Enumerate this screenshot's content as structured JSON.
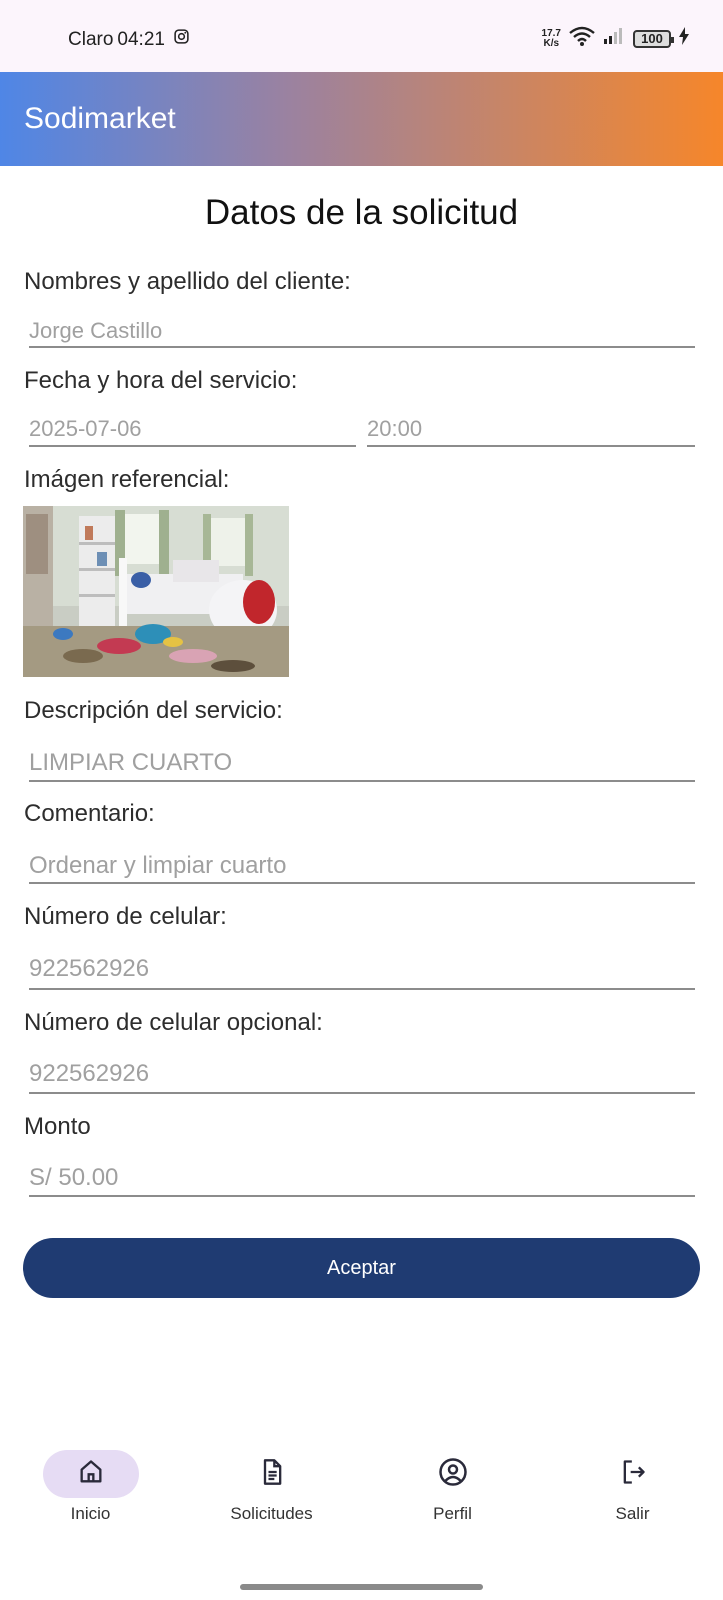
{
  "status_bar": {
    "carrier": "Claro",
    "time": "04:21",
    "net_speed_top": "17.7",
    "net_speed_bottom": "K/s",
    "battery": "100"
  },
  "app_bar": {
    "title": "Sodimarket"
  },
  "page": {
    "title": "Datos de la solicitud"
  },
  "form": {
    "client_label": "Nombres y apellido del cliente:",
    "client_value": "Jorge Castillo",
    "datetime_label": "Fecha y hora del servicio:",
    "date_value": "2025-07-06",
    "time_value": "20:00",
    "image_label": "Imágen referencial:",
    "description_label": "Descripción del servicio:",
    "description_value": "LIMPIAR CUARTO",
    "comment_label": "Comentario:",
    "comment_value": "Ordenar y limpiar cuarto",
    "phone_label": "Número de celular:",
    "phone_value": "922562926",
    "phone_opt_label": "Número de celular opcional:",
    "phone_opt_value": "922562926",
    "amount_label": "Monto",
    "amount_value": "S/ 50.00",
    "accept_label": "Aceptar"
  },
  "bottom_nav": {
    "items": [
      {
        "label": "Inicio",
        "icon": "home-icon",
        "active": true
      },
      {
        "label": "Solicitudes",
        "icon": "document-icon",
        "active": false
      },
      {
        "label": "Perfil",
        "icon": "account-circle-icon",
        "active": false
      },
      {
        "label": "Salir",
        "icon": "logout-icon",
        "active": false
      }
    ]
  },
  "colors": {
    "accent_button": "#1f3b72",
    "gradient_start": "#4f86e6",
    "gradient_end": "#f6862a",
    "active_nav_pill": "#e6dcf4"
  }
}
